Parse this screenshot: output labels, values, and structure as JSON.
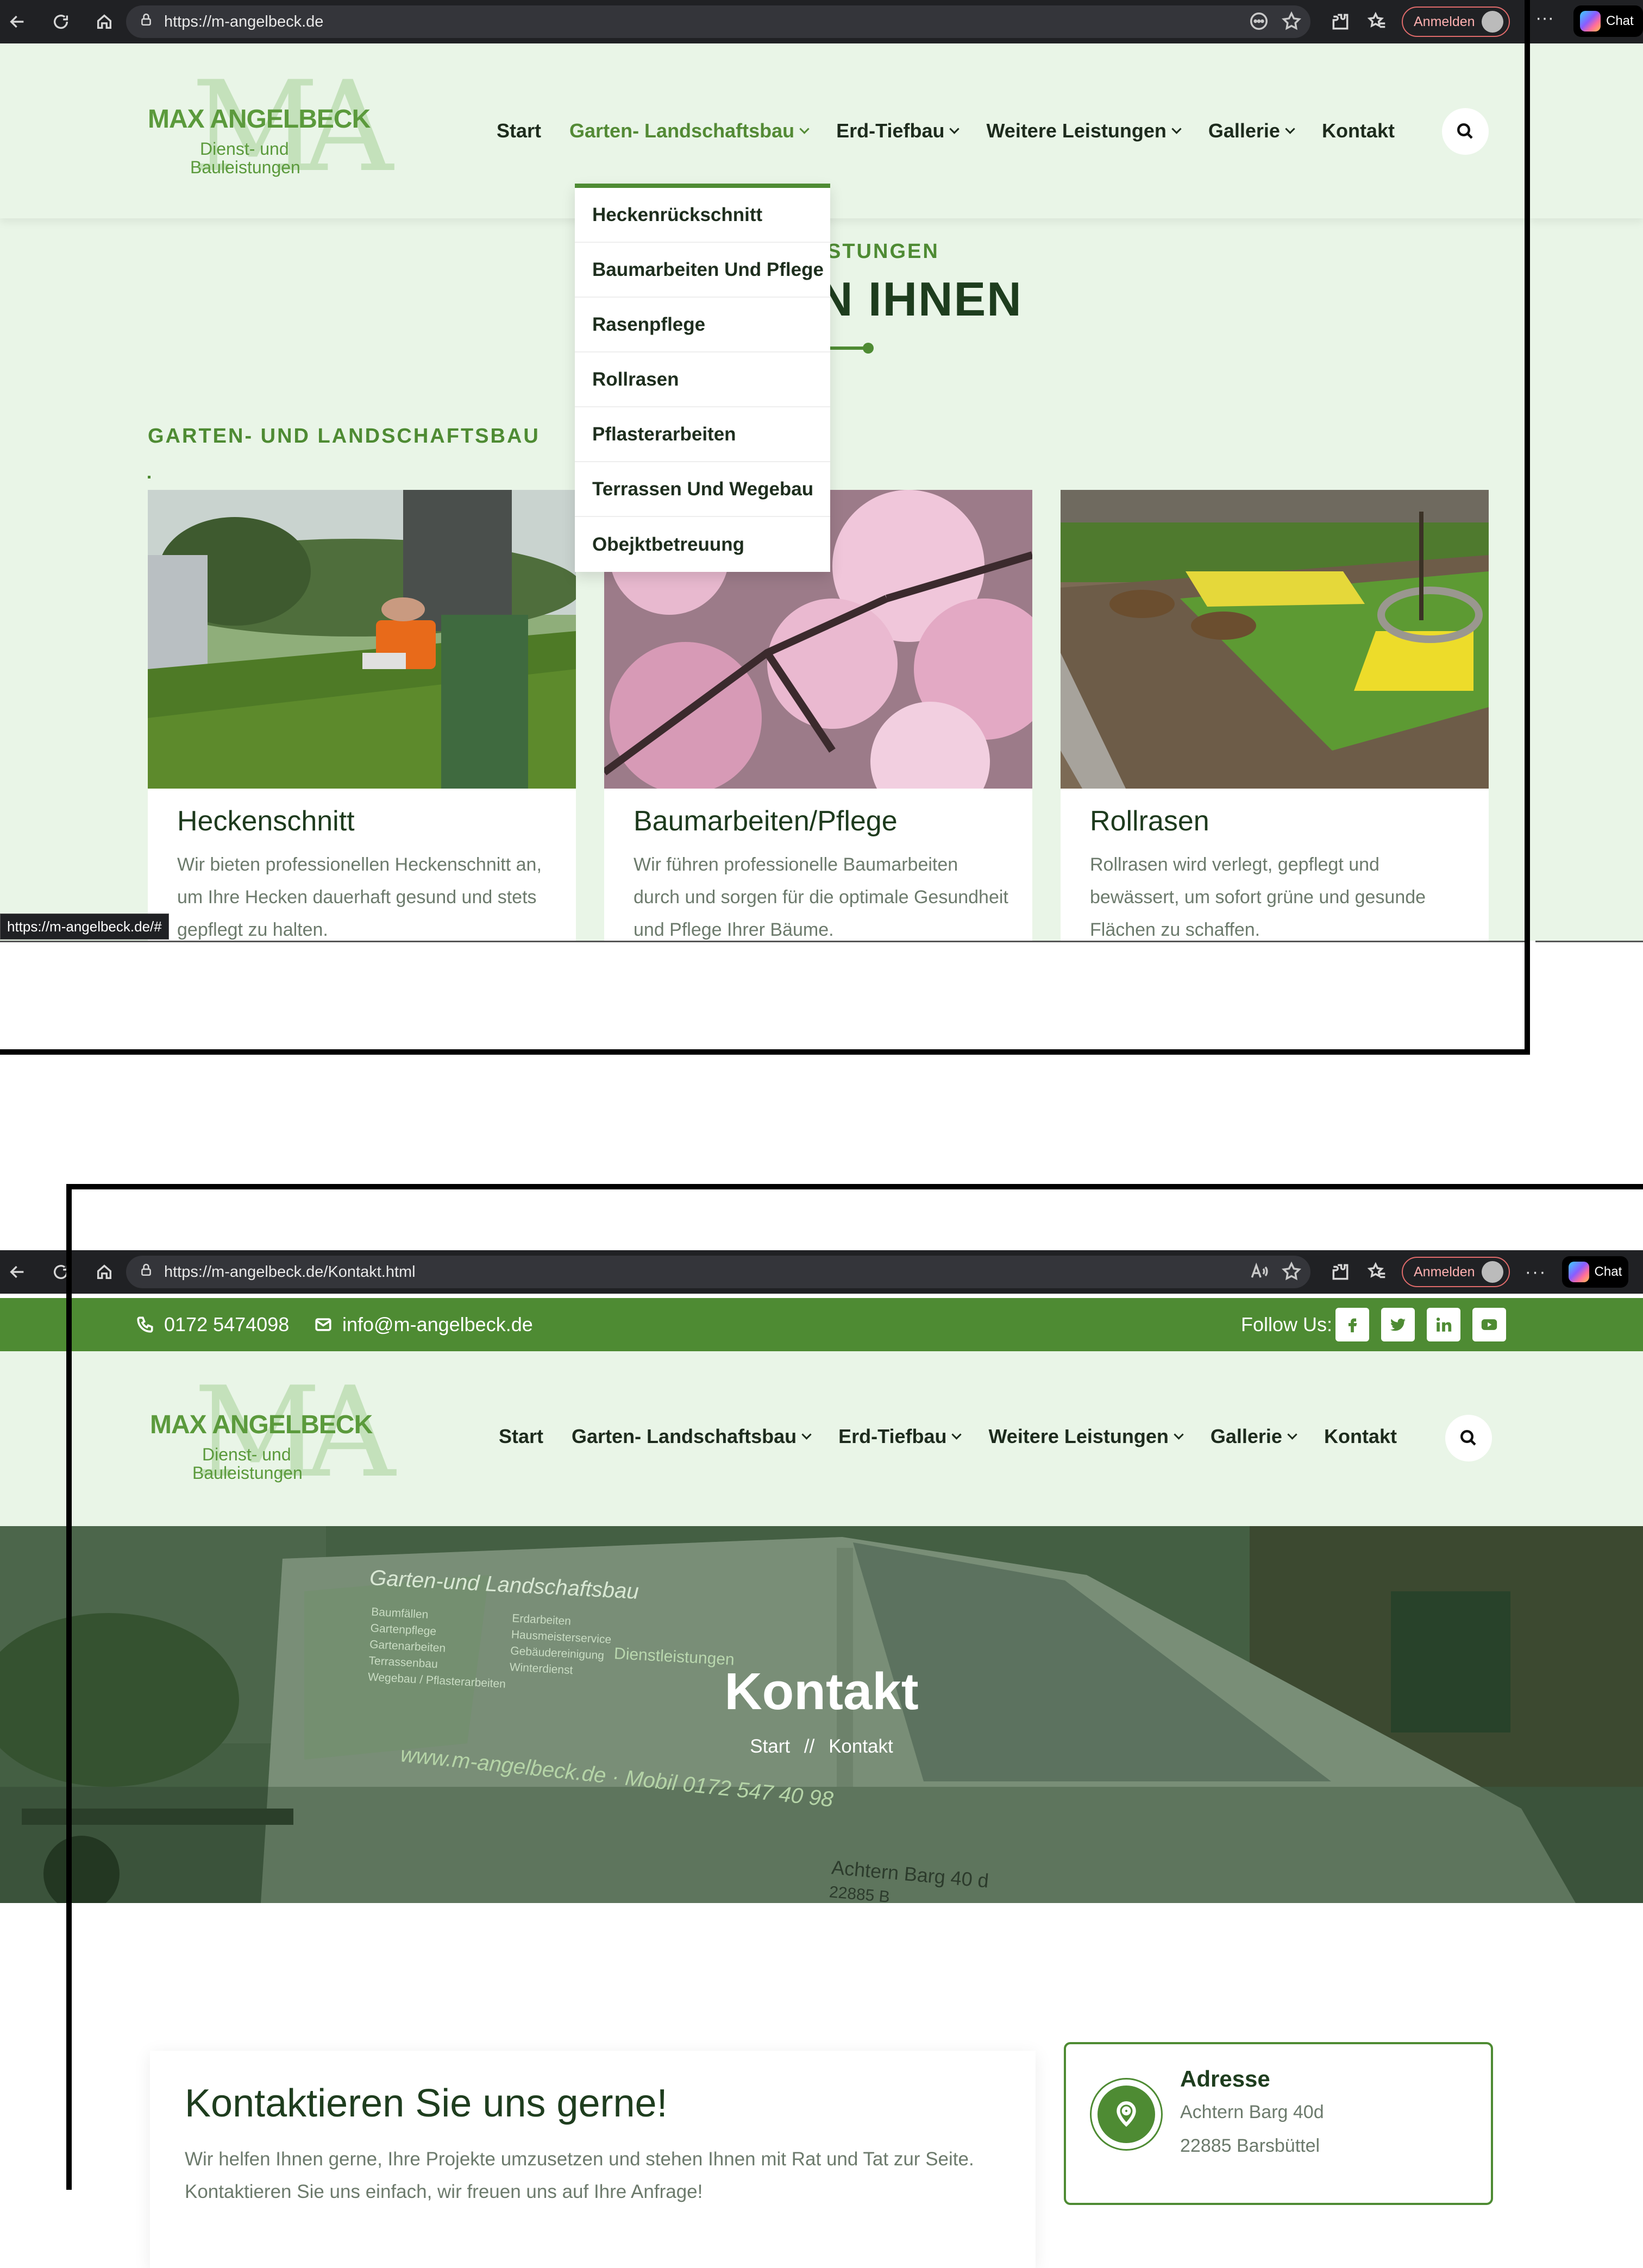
{
  "colors": {
    "brand_green": "#4e8b33",
    "header_bg": "#e9f5e7",
    "dark_text": "#1e3d1e"
  },
  "panel1": {
    "browser": {
      "url": "https://m-angelbeck.de",
      "signin_label": "Anmelden",
      "copilot_label": "Chat"
    },
    "brand": {
      "monogram": "MA",
      "name": "MAX ANGELBECK",
      "tagline_1": "Dienst- und",
      "tagline_2": "Bauleistungen"
    },
    "nav": {
      "start": "Start",
      "garten": "Garten- Landschaftsbau",
      "erd": "Erd-Tiefbau",
      "weitere": "Weitere Leistungen",
      "gallerie": "Gallerie",
      "kontakt": "Kontakt"
    },
    "dropdown": [
      "Heckenrückschnitt",
      "Baumarbeiten Und Pflege",
      "Rasenpflege",
      "Rollrasen",
      "Pflasterarbeiten",
      "Terrassen Und Wegebau",
      "Obejktbetreuung"
    ],
    "section": {
      "subtitle": "STUNGEN",
      "title": "N IHNEN"
    },
    "category": "GARTEN- UND LANDSCHAFTSBAU",
    "cards": [
      {
        "title": "Heckenschnitt",
        "text": "Wir bieten professionellen Heckenschnitt an, um Ihre Hecken dauerhaft gesund und stets gepflegt zu halten."
      },
      {
        "title": "Baumarbeiten/Pflege",
        "text": "Wir führen professionelle Baumarbeiten durch und sorgen für die optimale Gesundheit und Pflege Ihrer Bäume."
      },
      {
        "title": "Rollrasen",
        "text": "Rollrasen wird verlegt, gepflegt und bewässert, um sofort grüne und gesunde Flächen zu schaffen."
      }
    ],
    "status_url": "https://m-angelbeck.de/#"
  },
  "panel2": {
    "browser": {
      "url": "https://m-angelbeck.de/Kontakt.html",
      "signin_label": "Anmelden",
      "copilot_label": "Chat"
    },
    "topbar": {
      "phone": "0172 5474098",
      "email": "info@m-angelbeck.de",
      "follow_label": "Follow Us:"
    },
    "brand": {
      "monogram": "MA",
      "name": "MAX ANGELBECK",
      "tagline_1": "Dienst- und",
      "tagline_2": "Bauleistungen"
    },
    "nav": {
      "start": "Start",
      "garten": "Garten- Landschaftsbau",
      "erd": "Erd-Tiefbau",
      "weitere": "Weitere Leistungen",
      "gallerie": "Gallerie",
      "kontakt": "Kontakt"
    },
    "hero": {
      "title": "Kontakt",
      "crumb_home": "Start",
      "crumb_sep": "//",
      "crumb_current": "Kontakt"
    },
    "van_text": {
      "heading": "Garten-und Landschaftsbau",
      "col1": [
        "Baumfällen",
        "Gartenpflege",
        "Gartenarbeiten",
        "Terrassenbau",
        "Wegebau / Pflasterarbeiten"
      ],
      "col2": [
        "Erdarbeiten",
        "Hausmeisterservice",
        "Gebäudereinigung",
        "Winterdienst"
      ],
      "side": "Dienstleistungen",
      "web": "www.m-angelbeck.de · Mobil 0172 547 40 98",
      "street": "Achtern Barg 40 d",
      "zip": "22885 B"
    },
    "form": {
      "title": "Kontaktieren Sie uns gerne!",
      "text": "Wir helfen Ihnen gerne, Ihre Projekte umzusetzen und stehen Ihnen mit Rat und Tat zur Seite. Kontaktieren Sie uns einfach, wir freuen uns auf Ihre Anfrage!"
    },
    "address": {
      "title": "Adresse",
      "street": "Achtern Barg 40d",
      "city": "22885 Barsbüttel"
    }
  }
}
